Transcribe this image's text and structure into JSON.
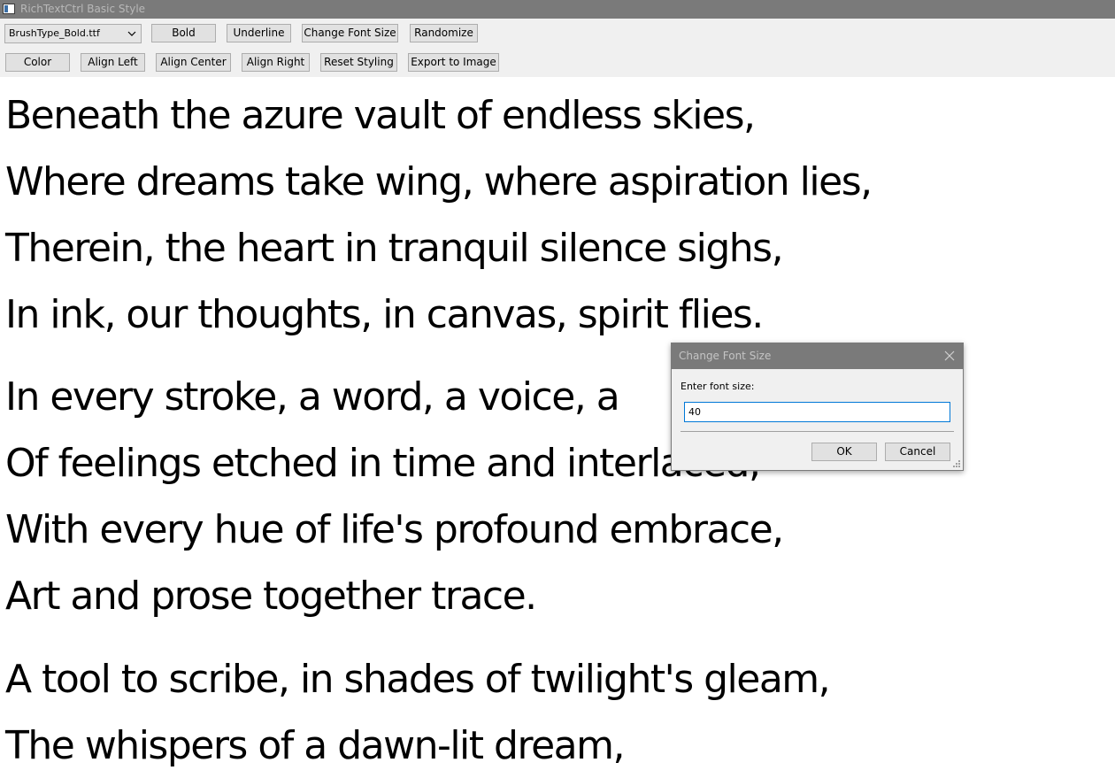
{
  "window": {
    "title": "RichTextCtrl Basic Style"
  },
  "toolbar": {
    "font_select": {
      "value": "BrushType_Bold.ttf"
    },
    "row1": [
      "Bold",
      "Underline",
      "Change Font Size",
      "Randomize"
    ],
    "row2": [
      "Color",
      "Align Left",
      "Align Center",
      "Align Right",
      "Reset Styling",
      "Export to Image"
    ]
  },
  "document": {
    "lines": [
      "Beneath the azure vault of endless skies,",
      "Where dreams take wing, where aspiration lies,",
      "Therein, the heart in tranquil silence sighs,",
      "In ink, our thoughts, in canvas, spirit flies.",
      "In every stroke, a word, a voice, a",
      "Of feelings etched in time and interlaced,",
      "With every hue of life's profound embrace,",
      "Art and prose together trace.",
      "A tool to scribe, in shades of twilight's gleam,",
      "The whispers of a dawn-lit dream,"
    ]
  },
  "dialog": {
    "title": "Change Font Size",
    "prompt": "Enter font size:",
    "input_value": "40",
    "ok_label": "OK",
    "cancel_label": "Cancel"
  },
  "colors": {
    "titlebar": "#7a7a7a",
    "toolbar_bg": "#f0f0f0",
    "button_bg": "#e1e1e1",
    "input_focus_border": "#0078d7"
  }
}
